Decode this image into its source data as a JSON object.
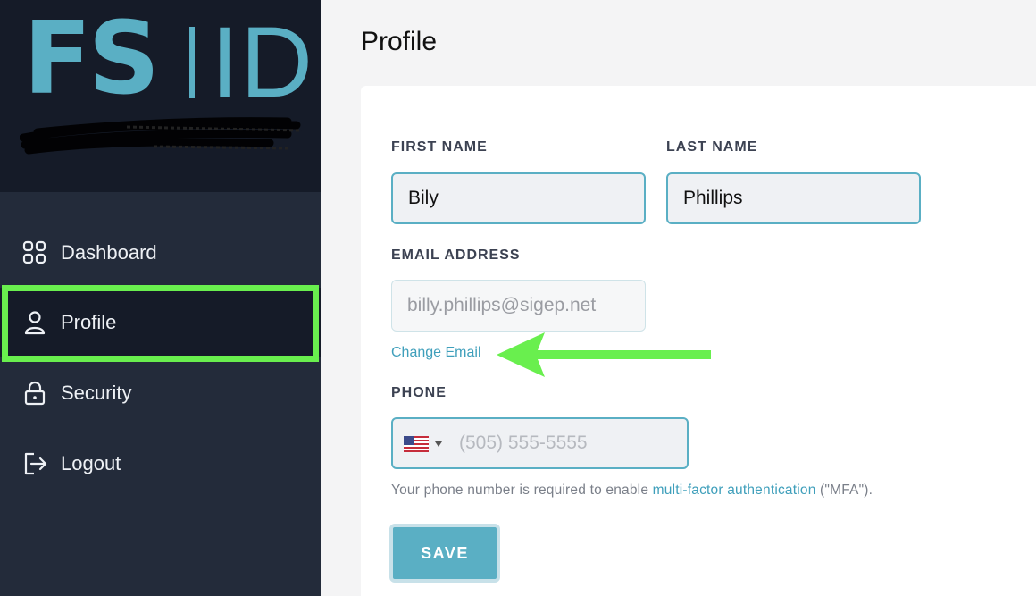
{
  "brand": {
    "logo_left": "FS",
    "logo_right": "ID"
  },
  "sidebar": {
    "items": [
      {
        "label": "Dashboard",
        "icon": "grid-icon"
      },
      {
        "label": "Profile",
        "icon": "user-icon"
      },
      {
        "label": "Security",
        "icon": "lock-icon"
      },
      {
        "label": "Logout",
        "icon": "logout-icon"
      }
    ],
    "active": "Profile"
  },
  "main": {
    "title": "Profile",
    "form": {
      "first_name_label": "FIRST NAME",
      "first_name_value": "Bily",
      "last_name_label": "LAST NAME",
      "last_name_value": "Phillips",
      "email_label": "EMAIL ADDRESS",
      "email_value": "billy.phillips@sigep.net",
      "change_email": "Change Email",
      "phone_label": "PHONE",
      "phone_placeholder": "(505) 555-5555",
      "help_prefix": "Your phone number is required to enable ",
      "help_link": "multi-factor authentication",
      "help_suffix": " (\"MFA\").",
      "save_label": "SAVE"
    }
  },
  "colors": {
    "accent": "#5aafc4",
    "sidebar_bg": "#232b3a",
    "sidebar_dark": "#151b28",
    "highlight": "#69ef4e"
  }
}
